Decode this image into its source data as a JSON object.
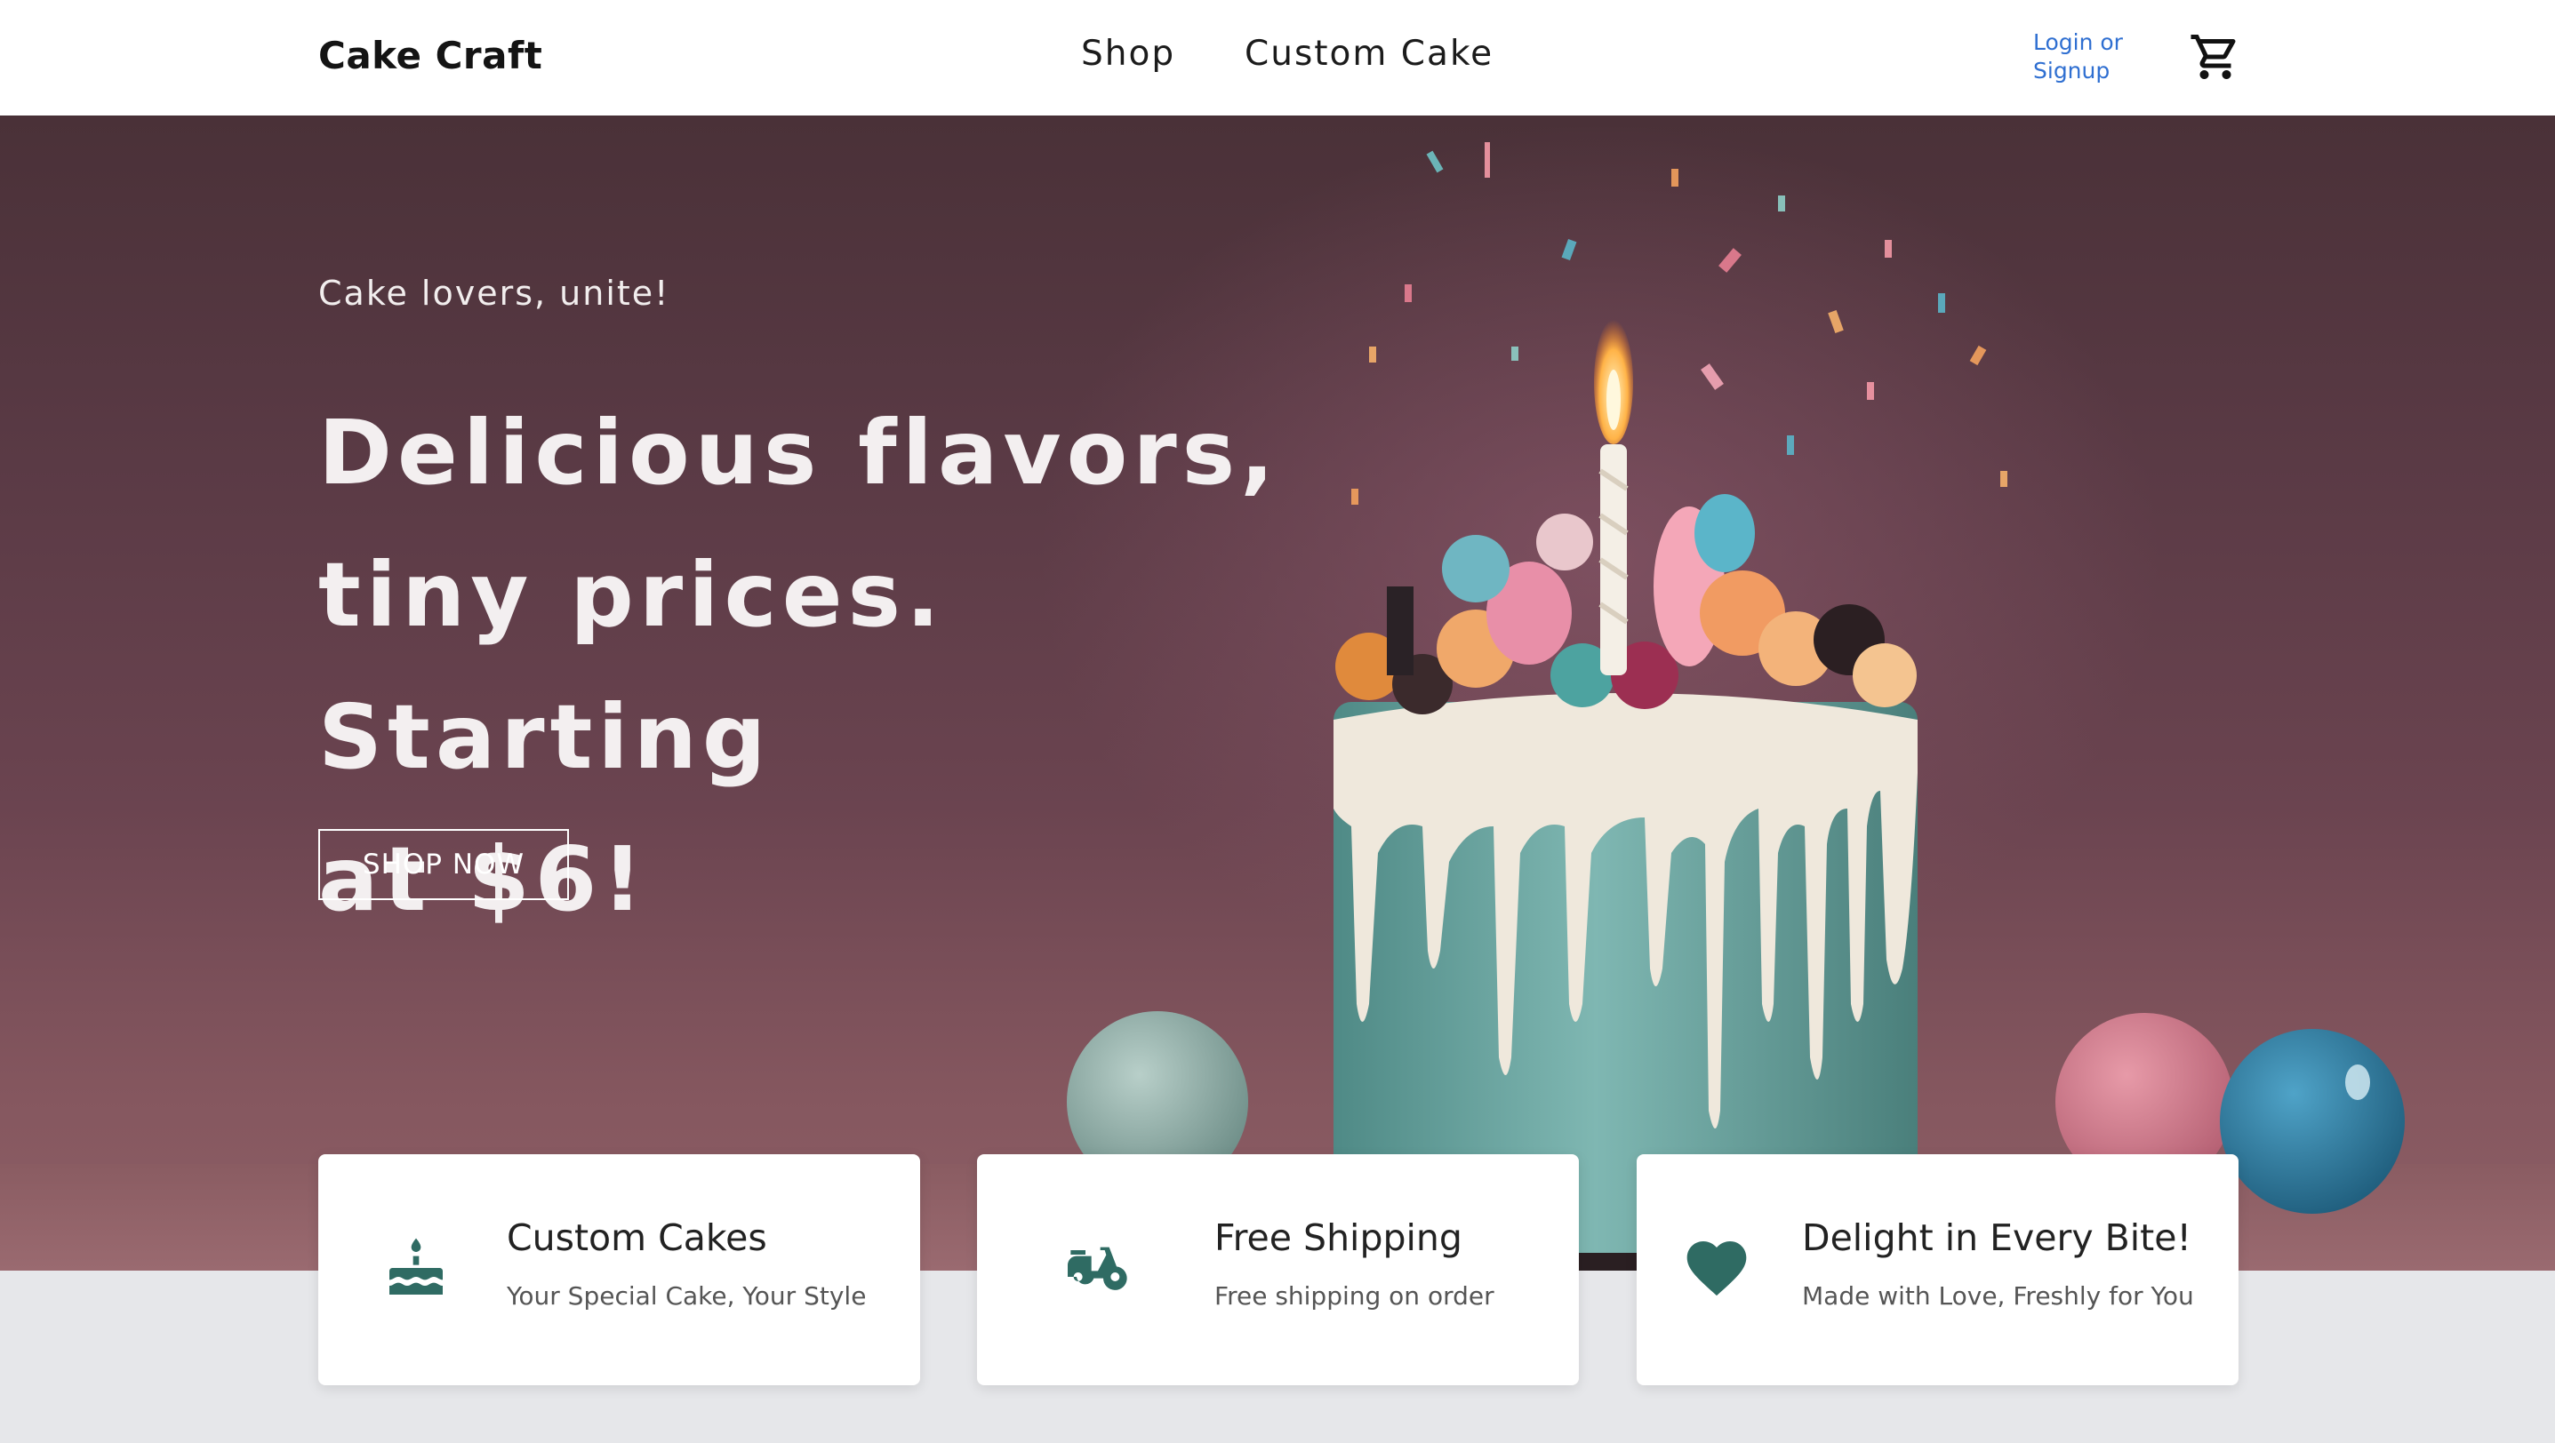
{
  "header": {
    "logo": "Cake Craft",
    "nav": [
      "Shop",
      "Custom Cake"
    ],
    "login_line1": "Login or",
    "login_line2": "Signup",
    "cart_icon": "shopping-cart-icon"
  },
  "hero": {
    "eyebrow": "Cake lovers, unite!",
    "headline_line1": "Delicious flavors,",
    "headline_line2": "tiny prices. Starting",
    "headline_line3": "at $6!",
    "cta": "SHOP NOW"
  },
  "features": [
    {
      "icon": "birthday-cake-icon",
      "title": "Custom Cakes",
      "subtitle": "Your Special Cake, Your Style"
    },
    {
      "icon": "scooter-icon",
      "title": "Free Shipping",
      "subtitle": "Free shipping on order"
    },
    {
      "icon": "heart-icon",
      "title": "Delight in Every Bite!",
      "subtitle": "Made with Love, Freshly for You"
    }
  ],
  "colors": {
    "accent_teal": "#2f6b63",
    "link_blue": "#2f6fd1",
    "hero_bg": "#5a3a45"
  }
}
